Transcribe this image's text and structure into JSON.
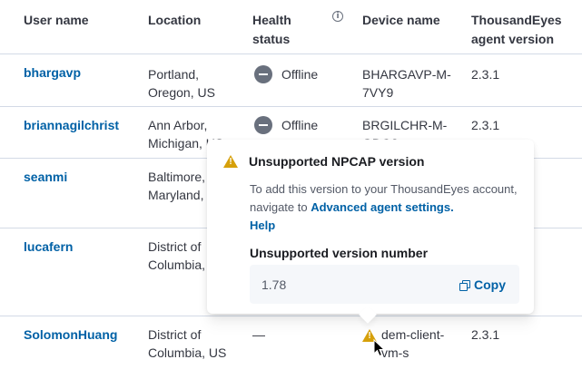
{
  "table": {
    "columns": {
      "user_name": "User name",
      "location": "Location",
      "health_status_line1": "Health",
      "health_status_line2": "status",
      "device_name": "Device name",
      "agent_version_line1": "ThousandEyes",
      "agent_version_line2": "agent version"
    },
    "info_icon": "info-icon",
    "rows": [
      {
        "user": "bhargavp",
        "location_line1": "Portland,",
        "location_line2": "Oregon, US",
        "status": "Offline",
        "device_line1": "BHARGAVP-M-",
        "device_line2": "7VY9",
        "version": "2.3.1"
      },
      {
        "user": "briannagilchrist",
        "location_line1": "Ann Arbor,",
        "location_line2": "Michigan, US",
        "status": "Offline",
        "device_line1": "BRGILCHR-M-",
        "device_line2": "GDO3",
        "version": "2.3.1"
      },
      {
        "user": "seanmi",
        "location_line1": "Baltimore,",
        "location_line2": "Maryland, US",
        "status": "",
        "device_line1": "",
        "device_line2": "",
        "version": ""
      },
      {
        "user": "lucafern",
        "location_line1": "District of",
        "location_line2": "Columbia, US",
        "status": "",
        "device_line1": "",
        "device_line2": "",
        "version": ""
      },
      {
        "user": "SolomonHuang",
        "location_line1": "District of",
        "location_line2": "Columbia, US",
        "status": "—",
        "device_line1": "dem-client-",
        "device_line2": "vm-s",
        "version": "2.3.1"
      }
    ]
  },
  "popover": {
    "title": "Unsupported NPCAP version",
    "body_text": "To add this version to your ThousandEyes account, navigate to ",
    "link_text": "Advanced agent settings.",
    "help_text": "Help",
    "subtitle": "Unsupported version number",
    "version_value": "1.78",
    "copy_label": "Copy"
  },
  "colors": {
    "link": "#0061a6",
    "warning": "#d6a00a",
    "offline_icon": "#69707d",
    "border": "#d3dae6"
  }
}
